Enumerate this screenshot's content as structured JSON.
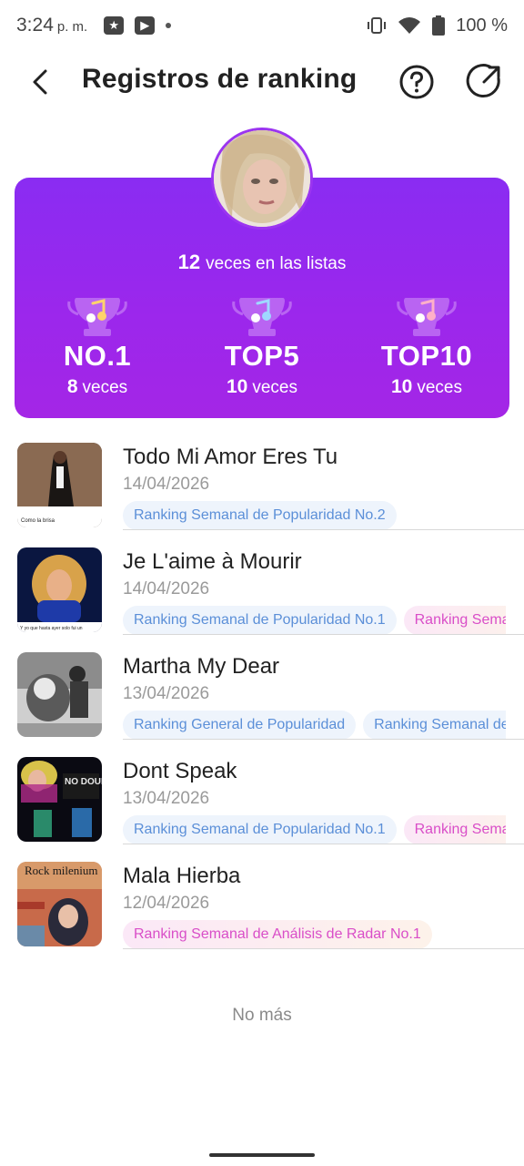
{
  "status_bar": {
    "time": "3:24",
    "ampm": "p. m.",
    "battery": "100 %"
  },
  "header": {
    "title": "Registros de ranking",
    "icons": [
      "back-arrow-icon",
      "help-circle-icon",
      "share-icon"
    ]
  },
  "summary": {
    "total_count": "12",
    "total_label": "veces en las listas",
    "stats": [
      {
        "title": "NO.1",
        "count": "8",
        "unit": "veces"
      },
      {
        "title": "TOP5",
        "count": "10",
        "unit": "veces"
      },
      {
        "title": "TOP10",
        "count": "10",
        "unit": "veces"
      }
    ],
    "accent": "#9b27ec"
  },
  "songs": [
    {
      "title": "Todo Mi Amor Eres Tu",
      "date": "14/04/2026",
      "tags": [
        {
          "text": "Ranking Semanal de Popularidad No.2",
          "style": "blue"
        }
      ]
    },
    {
      "title": "Je L'aime à Mourir",
      "date": "14/04/2026",
      "tags": [
        {
          "text": "Ranking Semanal de Popularidad No.1",
          "style": "blue"
        },
        {
          "text": "Ranking Seman",
          "style": "pink"
        }
      ]
    },
    {
      "title": "Martha My Dear",
      "date": "13/04/2026",
      "tags": [
        {
          "text": "Ranking General de Popularidad",
          "style": "blue"
        },
        {
          "text": "Ranking Semanal de",
          "style": "blue"
        }
      ]
    },
    {
      "title": "Dont Speak",
      "date": "13/04/2026",
      "tags": [
        {
          "text": "Ranking Semanal de Popularidad No.1",
          "style": "blue"
        },
        {
          "text": "Ranking Seman",
          "style": "pink"
        }
      ]
    },
    {
      "title": "Mala Hierba",
      "date": "12/04/2026",
      "tags": [
        {
          "text": "Ranking Semanal de Análisis de Radar No.1",
          "style": "pink"
        }
      ]
    }
  ],
  "covers": [
    {
      "text": "Como la brisa"
    },
    {
      "text": "Y yo que hasta ayer solo fui un"
    },
    {
      "text": ""
    },
    {
      "text": "NO DOUBT"
    },
    {
      "text": "Rock milenium"
    }
  ],
  "footer": {
    "no_more": "No más"
  }
}
